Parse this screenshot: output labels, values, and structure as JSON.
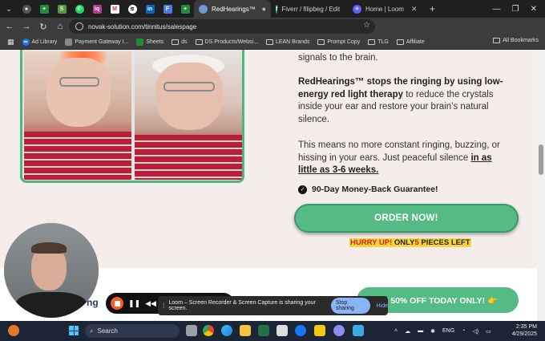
{
  "browser": {
    "tabs": [
      {
        "label": "RedHearings™",
        "active": true
      },
      {
        "label": "Fiverr / filipbeg / Edit",
        "active": false
      },
      {
        "label": "Home | Loom",
        "active": false
      }
    ],
    "new_tab": "+",
    "url": "novak-solution.com/tinnitus/salespage",
    "profile_initial": "F"
  },
  "bookmarks": {
    "items": [
      "Ad Library",
      "Payment Gateway I...",
      "Sheets",
      "ds",
      "DS Products/Websi...",
      "LEAN Brands",
      "Prompt Copy",
      "TLG",
      "Affiliate"
    ],
    "all": "All Bookmarks"
  },
  "page": {
    "intro_tail": "signals to the brain.",
    "brand": "RedHearings™",
    "highlight": "stops the ringing by using low-energy red light therapy",
    "rest": "to reduce the crystals inside your ear and restore your brain’s natural silence.",
    "para2_start": "This means no more constant ringing, buzzing, or hissing in your ears. Just peaceful silence",
    "para2_emph": "in as little as 3-6 weeks.",
    "guarantee": "90-Day Money-Back Guarantee!",
    "order_button": "ORDER NOW!",
    "hurry": "HURRY UP!",
    "only": "ONLY",
    "count": "5",
    "pieces": "PIECES LEFT",
    "offer_button": "ET 50% OFF TODAY ONLY! 👉",
    "partial_logo": "ng"
  },
  "loom": {
    "share_text": "Loom – Screen Recorder & Screen Capture is sharing your screen.",
    "stop": "Stop sharing",
    "hide": "Hide"
  },
  "taskbar": {
    "search": "Search",
    "lang": "ENG",
    "time": "2:35 PM",
    "date": "4/29/2025"
  },
  "colors": {
    "accent_green": "#55bb85",
    "hurry_red": "#d21f1f",
    "hurry_bg": "#f7d534",
    "loom_orange": "#ff5a2c"
  }
}
